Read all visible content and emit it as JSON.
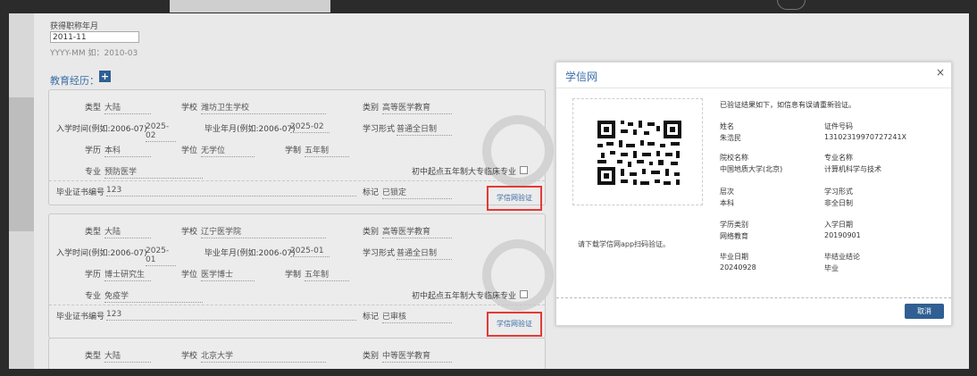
{
  "top": {
    "title_label": "获得职称年月",
    "title_value": "2011-11",
    "title_hint": "YYYY-MM 如：2010-03"
  },
  "education": {
    "header": "教育经历：",
    "add_icon": "plus-icon",
    "labels": {
      "type": "类型",
      "school": "学校",
      "category": "类别",
      "enroll": "入学时间(例如:2006-07)",
      "grad": "毕业年月(例如:2006-07)",
      "study_form": "学习形式",
      "edu_level": "学历",
      "degree": "学位",
      "length": "学制",
      "major": "专业",
      "special": "初中起点五年制大专临床专业",
      "cert_no": "毕业证书编号",
      "mark": "标记",
      "verify": "学信网验证"
    },
    "records": [
      {
        "type": "大陆",
        "school": "潍坊卫生学校",
        "category": "高等医学教育",
        "enroll": "2025-02",
        "grad": "2025-02",
        "study_form": "普通全日制",
        "edu_level": "本科",
        "degree": "无学位",
        "length": "五年制",
        "major": "预防医学",
        "cert_no": "123",
        "mark": "已锁定"
      },
      {
        "type": "大陆",
        "school": "辽宁医学院",
        "category": "高等医学教育",
        "enroll": "2025-01",
        "grad": "2025-01",
        "study_form": "普通全日制",
        "edu_level": "博士研究生",
        "degree": "医学博士",
        "length": "五年制",
        "major": "免疫学",
        "cert_no": "123",
        "mark": "已审核"
      },
      {
        "type": "大陆",
        "school": "北京大学",
        "category": "中等医学教育"
      }
    ]
  },
  "modal": {
    "title": "学信网",
    "close": "×",
    "qr_caption": "请下载学信网app扫码验证。",
    "notice": "已验证结果如下，如信息有误请重新验证。",
    "fields": [
      {
        "label": "姓名",
        "value": "朱浩民"
      },
      {
        "label": "证件号码",
        "value": "13102319970727241X"
      },
      {
        "label": "院校名称",
        "value": "中国地质大学(北京)"
      },
      {
        "label": "专业名称",
        "value": "计算机科学与技术"
      },
      {
        "label": "层次",
        "value": "本科"
      },
      {
        "label": "学习形式",
        "value": "非全日制"
      },
      {
        "label": "学历类别",
        "value": "网络教育"
      },
      {
        "label": "入学日期",
        "value": "20190901"
      },
      {
        "label": "毕业日期",
        "value": "20240928"
      },
      {
        "label": "毕结业结论",
        "value": "毕业"
      }
    ],
    "cancel": "取消"
  },
  "colors": {
    "accent": "#2f5f93",
    "link": "#3b6ea8",
    "highlight": "#e53935"
  }
}
